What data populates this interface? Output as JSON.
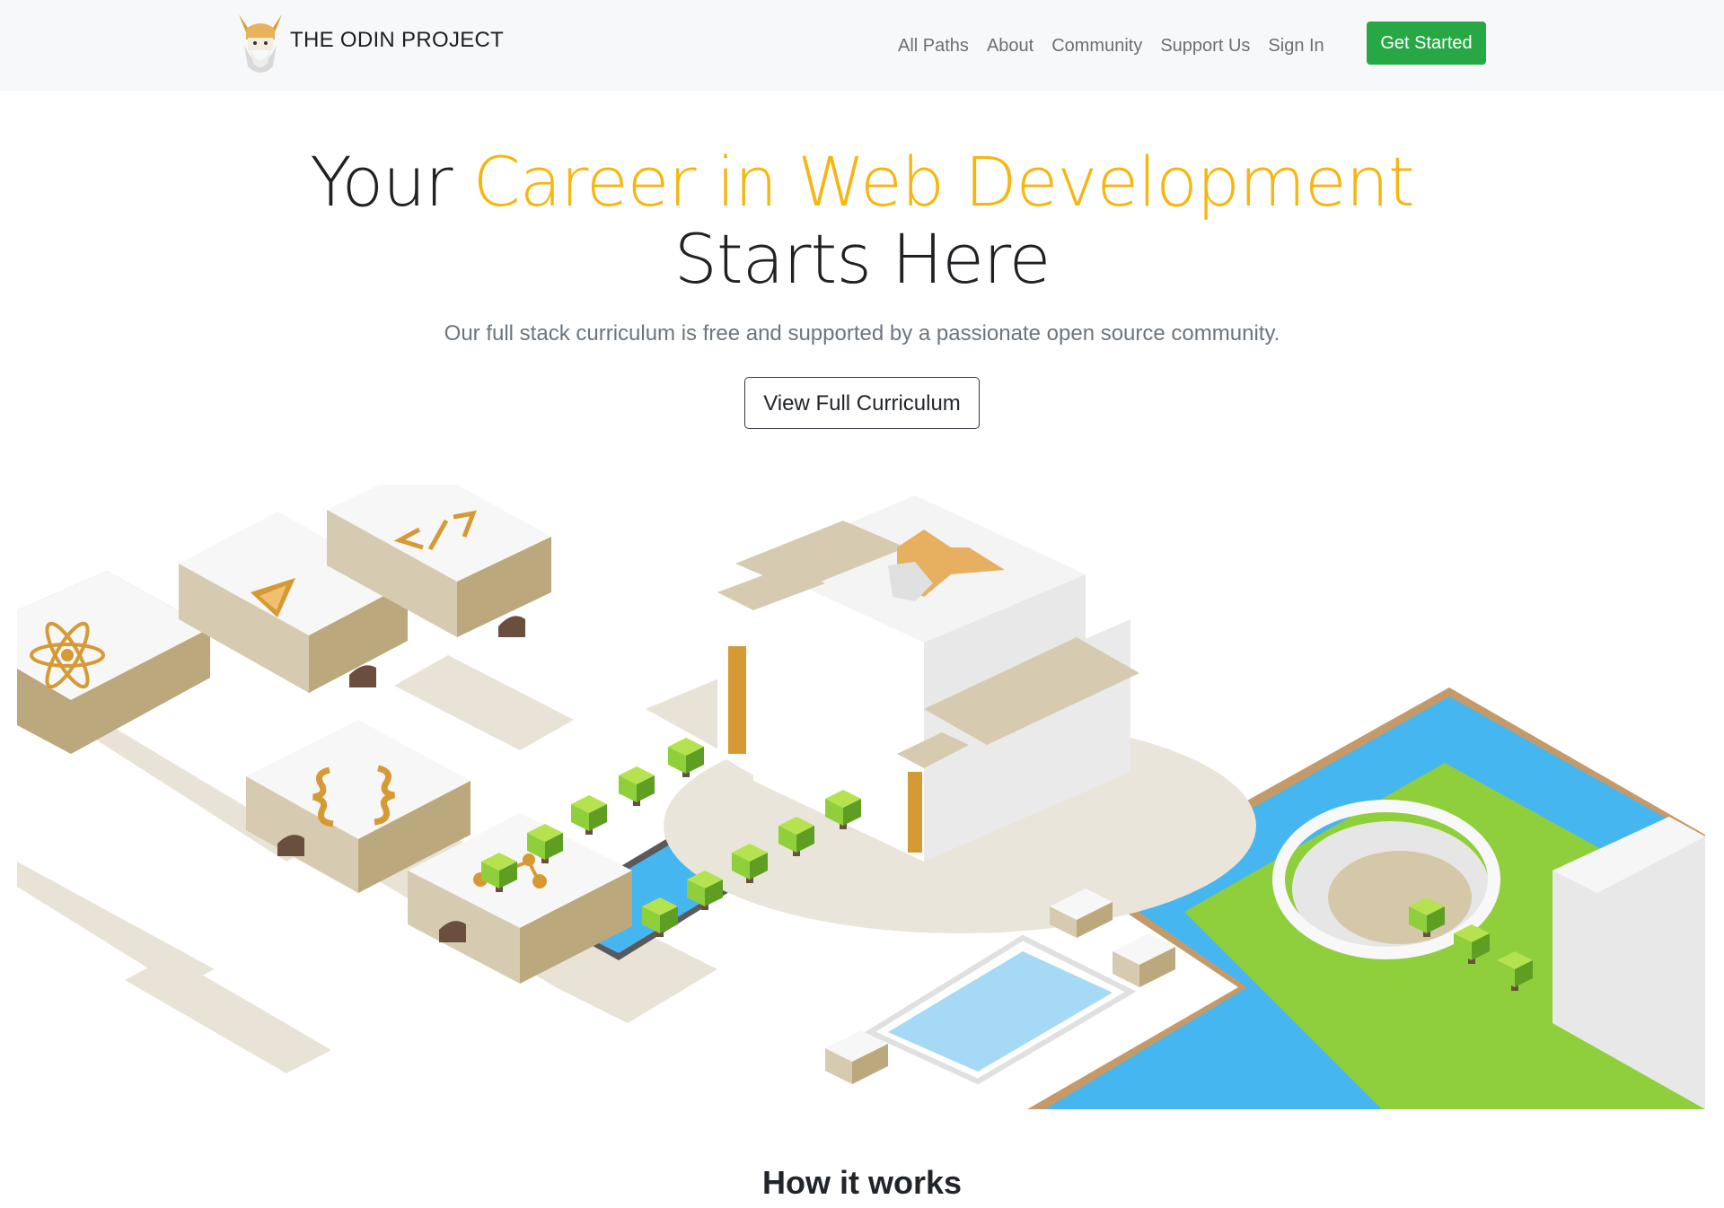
{
  "brand": {
    "name": "THE ODIN PROJECT"
  },
  "nav": {
    "links": [
      "All Paths",
      "About",
      "Community",
      "Support Us",
      "Sign In"
    ],
    "cta": "Get Started"
  },
  "hero": {
    "title_start": "Your",
    "title_highlight": "Career in Web Development",
    "title_end": "Starts Here",
    "subtitle": "Our full stack curriculum is free and supported by a passionate open source community.",
    "button": "View Full Curriculum"
  },
  "section": {
    "heading": "How it works"
  },
  "colors": {
    "accent": "#f6b60f",
    "cta": "#28a745",
    "water": "#45b6ef",
    "grass": "#8fcf3c",
    "tan": "#d6cbb0"
  },
  "icons": [
    "odin-logo-icon",
    "atom-icon",
    "angular-icon",
    "code-tag-icon",
    "curly-braces-icon",
    "git-branch-icon"
  ]
}
